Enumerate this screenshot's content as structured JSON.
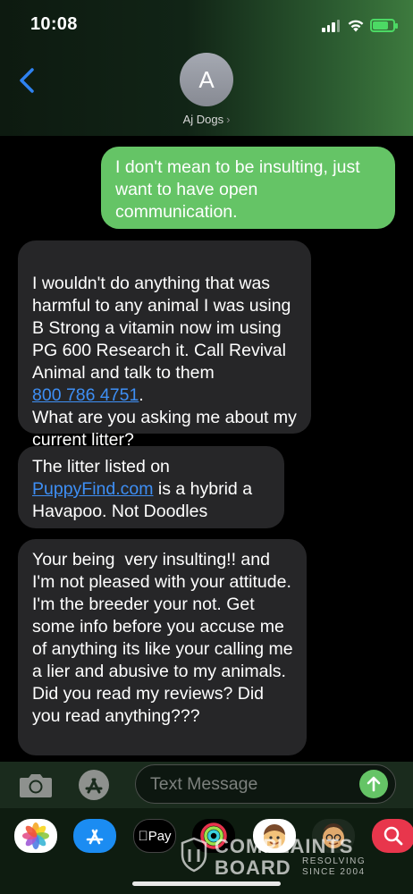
{
  "status_bar": {
    "time": "10:08"
  },
  "header": {
    "avatar_initial": "A",
    "contact_name": "Aj Dogs",
    "chevron": "›"
  },
  "messages": [
    {
      "direction": "sent",
      "text": "I don't mean to be insulting, just want to have open communication."
    },
    {
      "direction": "received",
      "text_before": "I wouldn't do anything that was harmful to any animal I was using B Strong a vitamin now im using PG 600 Research it. Call Revival Animal and talk to them",
      "link": "800 786 4751",
      "text_after": ".\nWhat are you asking me about my current litter?"
    },
    {
      "direction": "received",
      "text_before": "The litter listed on",
      "link": "PuppyFind.com",
      "text_after": " is a hybrid a Havapoo. Not Doodles"
    },
    {
      "direction": "received",
      "text": "Your being  very insulting!! and I'm not pleased with your attitude. I'm the breeder your not. Get some info before you accuse me of anything its like your calling me a lier and abusive to my animals. Did you read my reviews? Did you read anything???"
    }
  ],
  "input": {
    "placeholder": "Text Message"
  },
  "app_drawer": {
    "apps": [
      {
        "icon": "photos-icon"
      },
      {
        "icon": "app-store-icon"
      },
      {
        "icon": "apple-pay-icon",
        "label": "Pay"
      },
      {
        "icon": "activity-icon"
      },
      {
        "icon": "memoji-icon"
      },
      {
        "icon": "memoji-icon-2"
      },
      {
        "icon": "search-web-icon"
      }
    ]
  },
  "watermark": {
    "line1": "COMPLAINTS",
    "line2": "BOARD",
    "tag1": "RESOLVING",
    "tag2": "SINCE 2004"
  },
  "colors": {
    "sent_bubble": "#65c466",
    "received_bubble": "#262628",
    "link": "#3e8ff5",
    "accent_blue": "#2f82f0"
  }
}
